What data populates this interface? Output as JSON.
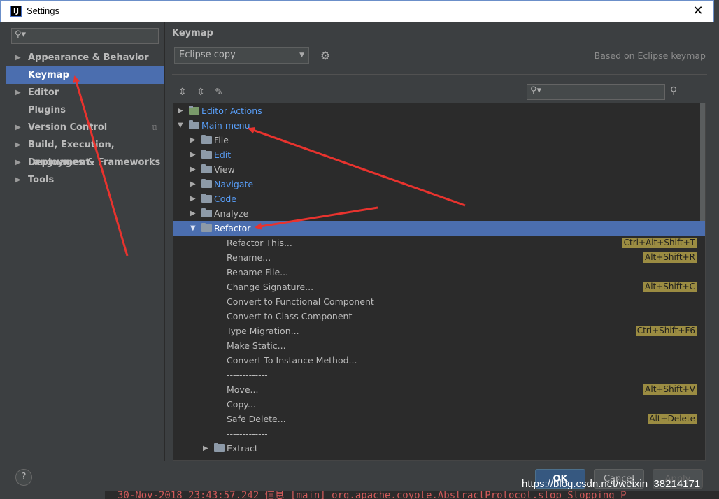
{
  "window": {
    "title": "Settings",
    "close_glyph": "✕",
    "app_icon_letter": "IJ"
  },
  "sidebar": {
    "search_placeholder": "",
    "items": [
      {
        "label": "Appearance & Behavior",
        "expandable": true
      },
      {
        "label": "Keymap",
        "expandable": false,
        "selected": true
      },
      {
        "label": "Editor",
        "expandable": true
      },
      {
        "label": "Plugins",
        "expandable": false
      },
      {
        "label": "Version Control",
        "expandable": true
      },
      {
        "label": "Build, Execution, Deployment",
        "expandable": true
      },
      {
        "label": "Languages & Frameworks",
        "expandable": true
      },
      {
        "label": "Tools",
        "expandable": true
      }
    ]
  },
  "keymap": {
    "heading": "Keymap",
    "selected_keymap": "Eclipse copy",
    "based_on": "Based on Eclipse keymap"
  },
  "tree": {
    "rows": [
      {
        "label": "Editor Actions",
        "indent": 0,
        "expanded": false,
        "icon": "editor-actions-icon",
        "blue": true,
        "shortcut": ""
      },
      {
        "label": "Main menu",
        "indent": 0,
        "expanded": true,
        "icon": "main-menu-icon",
        "blue": true,
        "shortcut": ""
      },
      {
        "label": "File",
        "indent": 1,
        "expanded": false,
        "icon": "folder",
        "blue": false,
        "shortcut": ""
      },
      {
        "label": "Edit",
        "indent": 1,
        "expanded": false,
        "icon": "folder",
        "blue": true,
        "shortcut": ""
      },
      {
        "label": "View",
        "indent": 1,
        "expanded": false,
        "icon": "folder",
        "blue": false,
        "shortcut": ""
      },
      {
        "label": "Navigate",
        "indent": 1,
        "expanded": false,
        "icon": "folder",
        "blue": true,
        "shortcut": ""
      },
      {
        "label": "Code",
        "indent": 1,
        "expanded": false,
        "icon": "folder",
        "blue": true,
        "shortcut": ""
      },
      {
        "label": "Analyze",
        "indent": 1,
        "expanded": false,
        "icon": "folder",
        "blue": false,
        "shortcut": ""
      },
      {
        "label": "Refactor",
        "indent": 1,
        "expanded": true,
        "icon": "folder",
        "blue": true,
        "selected": true,
        "shortcut": ""
      },
      {
        "label": "Refactor This...",
        "indent": 2,
        "leaf": true,
        "shortcut": "Ctrl+Alt+Shift+T"
      },
      {
        "label": "Rename...",
        "indent": 2,
        "leaf": true,
        "shortcut": "Alt+Shift+R"
      },
      {
        "label": "Rename File...",
        "indent": 2,
        "leaf": true,
        "shortcut": ""
      },
      {
        "label": "Change Signature...",
        "indent": 2,
        "leaf": true,
        "shortcut": "Alt+Shift+C"
      },
      {
        "label": "Convert to Functional Component",
        "indent": 2,
        "leaf": true,
        "shortcut": ""
      },
      {
        "label": "Convert to Class Component",
        "indent": 2,
        "leaf": true,
        "shortcut": ""
      },
      {
        "label": "Type Migration...",
        "indent": 2,
        "leaf": true,
        "shortcut": "Ctrl+Shift+F6"
      },
      {
        "label": "Make Static...",
        "indent": 2,
        "leaf": true,
        "shortcut": ""
      },
      {
        "label": "Convert To Instance Method...",
        "indent": 2,
        "leaf": true,
        "shortcut": ""
      },
      {
        "label": "-------------",
        "indent": 2,
        "leaf": true,
        "shortcut": ""
      },
      {
        "label": "Move...",
        "indent": 2,
        "leaf": true,
        "shortcut": "Alt+Shift+V"
      },
      {
        "label": "Copy...",
        "indent": 2,
        "leaf": true,
        "shortcut": ""
      },
      {
        "label": "Safe Delete...",
        "indent": 2,
        "leaf": true,
        "shortcut": "Alt+Delete"
      },
      {
        "label": "-------------",
        "indent": 2,
        "leaf": true,
        "shortcut": ""
      },
      {
        "label": "Extract",
        "indent": 2,
        "expanded": false,
        "icon": "folder",
        "blue": false,
        "shortcut": ""
      }
    ]
  },
  "footer": {
    "help": "?",
    "ok": "OK",
    "cancel": "Cancel",
    "apply": "Apply"
  },
  "background": {
    "console_text": "30-Nov-2018 23:43:57.242 信息 [main] org.apache.coyote.AbstractProtocol.stop Stopping P",
    "watermark": "https://blog.csdn.net/weixin_38214171"
  },
  "colors": {
    "selection": "#4b6eaf",
    "link_blue": "#589df6",
    "shortcut_bg": "#9b8c42",
    "annotation_red": "#e8332e"
  }
}
